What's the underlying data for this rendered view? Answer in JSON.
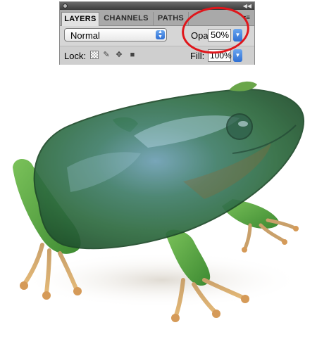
{
  "panel": {
    "tabs": [
      {
        "label": "LAYERS",
        "active": true
      },
      {
        "label": "CHANNELS",
        "active": false
      },
      {
        "label": "PATHS",
        "active": false
      }
    ],
    "blend_mode": "Normal",
    "opacity_label": "Opacity:",
    "opacity_value": "50%",
    "lock_label": "Lock:",
    "fill_label": "Fill:",
    "fill_value": "100%",
    "icons": [
      "lock-transparent-pixels-icon",
      "lock-image-pixels-icon",
      "lock-position-icon",
      "lock-all-icon",
      "panel-menu-icon"
    ]
  },
  "annotation": {
    "shape": "circle",
    "color": "#e0161b",
    "target": "opacity"
  },
  "image": {
    "subject": "frog-photo",
    "body_color": "#3f8a5a",
    "leg_color": "#5fa844",
    "toe_color": "#d7a35a"
  }
}
